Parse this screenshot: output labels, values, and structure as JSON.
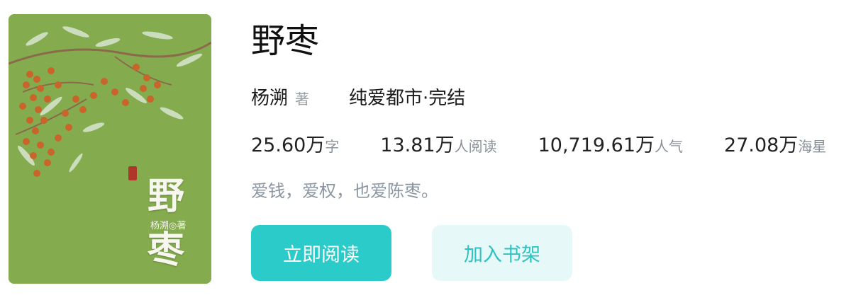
{
  "book": {
    "title": "野枣",
    "author": "杨溯",
    "author_suffix": "著",
    "category": "纯爱都市·完结"
  },
  "cover": {
    "title_line1": "野",
    "title_line2": "枣",
    "author_line": "杨溯◎著",
    "background_color": "#7fa84a",
    "berry_color": "#c9642a"
  },
  "stats": [
    {
      "value": "25.60万",
      "unit": "字"
    },
    {
      "value": "13.81万",
      "unit": "人阅读"
    },
    {
      "value": "10,719.61万",
      "unit": "人气"
    },
    {
      "value": "27.08万",
      "unit": "海星"
    }
  ],
  "intro": "爱钱，爱权，也爱陈枣。",
  "actions": {
    "read_label": "立即阅读",
    "shelf_label": "加入书架"
  },
  "colors": {
    "accent": "#2bcbc9",
    "accent_light": "#e6f8f7",
    "muted": "#8b95a1"
  }
}
